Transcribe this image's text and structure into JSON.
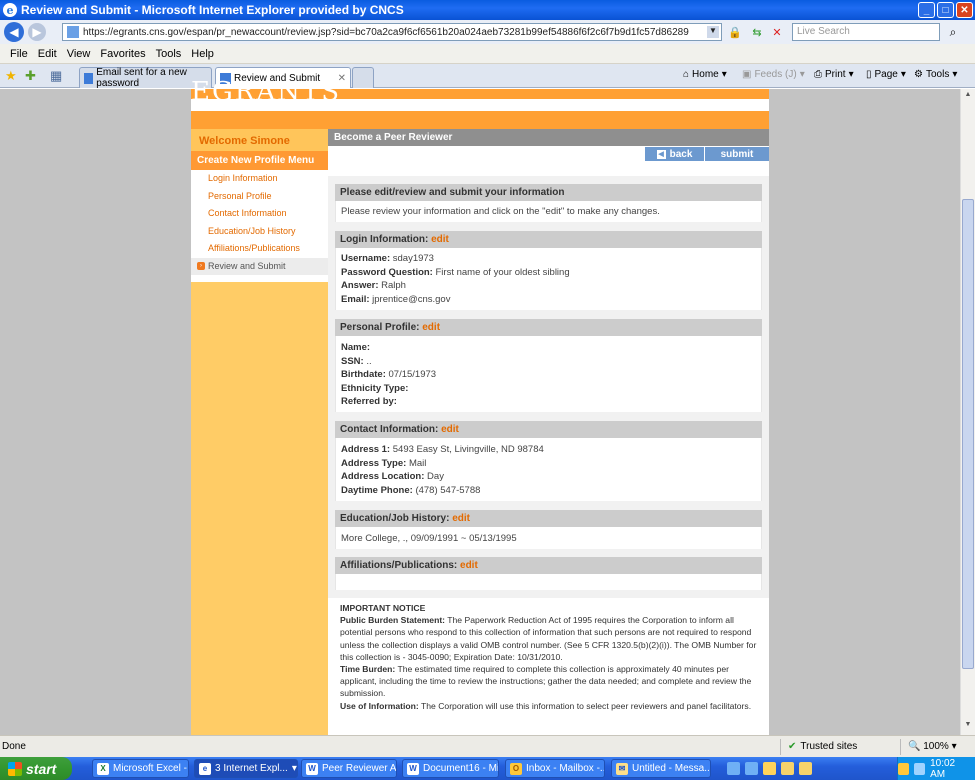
{
  "window": {
    "title": "Review and Submit - Microsoft Internet Explorer provided by CNCS"
  },
  "address": {
    "url": "https://egrants.cns.gov/espan/pr_newaccount/review.jsp?sid=bc70a2ca9f6cf6561b20a024aeb73281b99ef54886f6f2c6f7b9d1fc57d86289",
    "search_placeholder": "Live Search"
  },
  "menu": [
    "File",
    "Edit",
    "View",
    "Favorites",
    "Tools",
    "Help"
  ],
  "tabs": [
    {
      "label": "Email sent for a new password"
    },
    {
      "label": "Review and Submit"
    }
  ],
  "toolbar": {
    "home": "Home",
    "feeds": "Feeds (J)",
    "print": "Print",
    "page": "Page",
    "tools": "Tools"
  },
  "site": {
    "logo": "EGRANTS"
  },
  "leftnav": {
    "welcome": "Welcome Simone",
    "menu_title": "Create New Profile Menu",
    "items": [
      "Login Information",
      "Personal Profile",
      "Contact Information",
      "Education/Job History",
      "Affiliations/Publications",
      "Review and Submit"
    ]
  },
  "page": {
    "header": "Become a Peer Reviewer",
    "back_label": "back",
    "submit_label": "submit",
    "intro_title": "Please edit/review and submit your information",
    "intro_text": "Please review your information and click on the \"edit\" to make any changes.",
    "edit_label": "edit"
  },
  "sections": {
    "login": {
      "title": "Login Information:",
      "username_label": "Username:",
      "username": "sday1973",
      "question_label": "Password Question:",
      "question": "First name of your oldest sibling",
      "answer_label": "Answer:",
      "answer": "Ralph",
      "email_label": "Email:",
      "email": "jprentice@cns.gov"
    },
    "personal": {
      "title": "Personal Profile:",
      "name_label": "Name:",
      "ssn_label": "SSN:",
      "ssn": "..",
      "birthdate_label": "Birthdate:",
      "birthdate": "07/15/1973",
      "ethnicity_label": "Ethnicity Type:",
      "referred_label": "Referred by:"
    },
    "contact": {
      "title": "Contact Information:",
      "address1_label": "Address 1:",
      "address1": "5493 Easy St, Livingville, ND 98784",
      "type_label": "Address Type:",
      "type": "Mail",
      "location_label": "Address Location:",
      "location": "Day",
      "phone_label": "Daytime Phone:",
      "phone": "(478) 547-5788"
    },
    "education": {
      "title": "Education/Job History:",
      "entry": "More College, ., 09/09/1991 ~ 05/13/1995"
    },
    "affiliations": {
      "title": "Affiliations/Publications:"
    }
  },
  "notice": {
    "title": "IMPORTANT NOTICE",
    "pbs_label": "Public Burden Statement:",
    "pbs_text": "The Paperwork Reduction Act of 1995 requires the Corporation to inform all potential persons who respond to this collection of information that such persons are not required to respond unless the collection displays a valid OMB control number. (See 5 CFR 1320.5(b)(2)(i)). The OMB Number for this collection is - 3045-0090; Expiration Date: 10/31/2010.",
    "tb_label": "Time Burden:",
    "tb_text": "The estimated time required to complete this collection is approximately 40 minutes per applicant, including the time to review the instructions; gather the data needed; and complete and review the submission.",
    "use_label": "Use of Information:",
    "use_text": "The Corporation will use this information to select peer reviewers and panel facilitators."
  },
  "status": {
    "text": "Done",
    "zone": "Trusted sites",
    "zoom": "100%"
  },
  "taskbar": {
    "start": "start",
    "items": [
      "Microsoft Excel - ...",
      "3 Internet Expl...",
      "Peer Reviewer A...",
      "Document16 - Mi...",
      "Inbox - Mailbox -...",
      "Untitled - Messa..."
    ],
    "clock": "10:02 AM"
  }
}
